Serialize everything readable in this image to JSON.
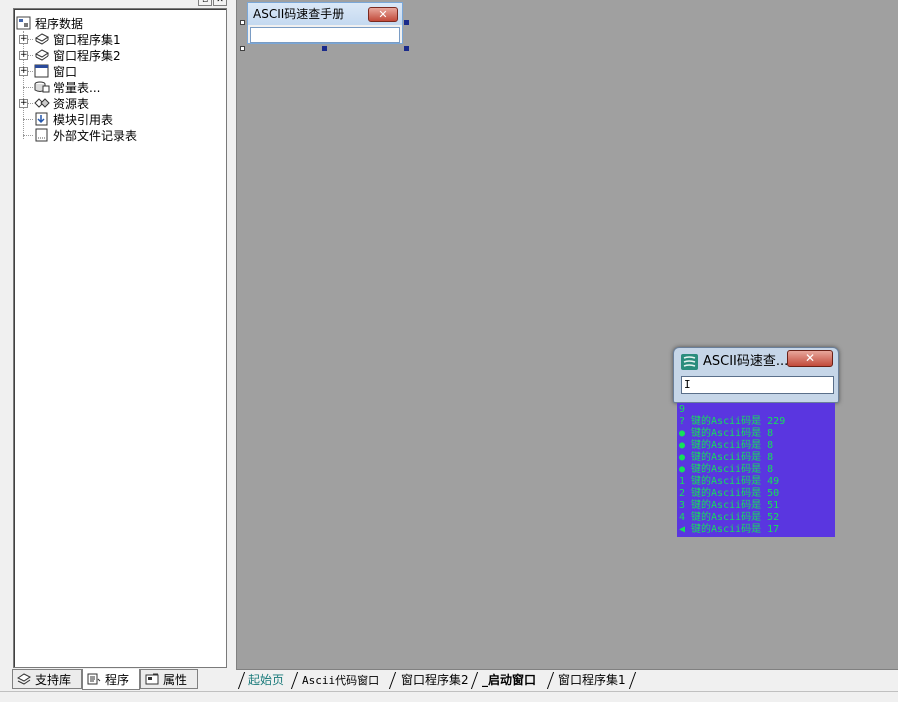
{
  "project_tree": {
    "root": {
      "label": "程序数据",
      "icon": "program-data-icon"
    },
    "items": [
      {
        "label": "窗口程序集1",
        "icon": "assembly-icon",
        "expandable": true
      },
      {
        "label": "窗口程序集2",
        "icon": "assembly-icon",
        "expandable": true
      },
      {
        "label": "窗口",
        "icon": "window-icon",
        "expandable": true
      },
      {
        "label": "常量表...",
        "icon": "constants-icon",
        "expandable": false
      },
      {
        "label": "资源表",
        "icon": "resources-icon",
        "expandable": true
      },
      {
        "label": "模块引用表",
        "icon": "module-ref-icon",
        "expandable": false
      },
      {
        "label": "外部文件记录表",
        "icon": "external-file-icon",
        "expandable": false
      }
    ]
  },
  "panel_tabs": [
    {
      "label": "支持库",
      "icon": "library-icon",
      "active": false
    },
    {
      "label": "程序",
      "icon": "program-icon",
      "active": true
    },
    {
      "label": "属性",
      "icon": "properties-icon",
      "active": false
    }
  ],
  "design_form": {
    "title": "ASCII码速查手册",
    "close_symbol": "✕"
  },
  "runtime_window": {
    "title": "ASCII码速查...",
    "close_symbol": "✕",
    "input_value": "I"
  },
  "ascii_output": {
    "lines": [
      "9",
      "? 键的Ascii码是 229",
      "● 键的Ascii码是 8",
      "● 键的Ascii码是 8",
      "● 键的Ascii码是 8",
      "● 键的Ascii码是 8",
      "1 键的Ascii码是 49",
      "2 键的Ascii码是 50",
      "3 键的Ascii码是 51",
      "4 键的Ascii码是 52",
      "◀ 键的Ascii码是 17"
    ]
  },
  "doc_tabs": [
    {
      "label": "起始页",
      "active": false,
      "color": "#1a7a7a"
    },
    {
      "label": "Ascii代码窗口",
      "active": false,
      "color": "#000000"
    },
    {
      "label": "窗口程序集2",
      "active": false,
      "color": "#000000"
    },
    {
      "label": "_启动窗口",
      "active": true,
      "color": "#000000"
    },
    {
      "label": "窗口程序集1",
      "active": false,
      "color": "#000000"
    }
  ],
  "colors": {
    "design_background": "#a0a0a0",
    "output_background": "#5a36e0",
    "output_text": "#14e05a"
  }
}
